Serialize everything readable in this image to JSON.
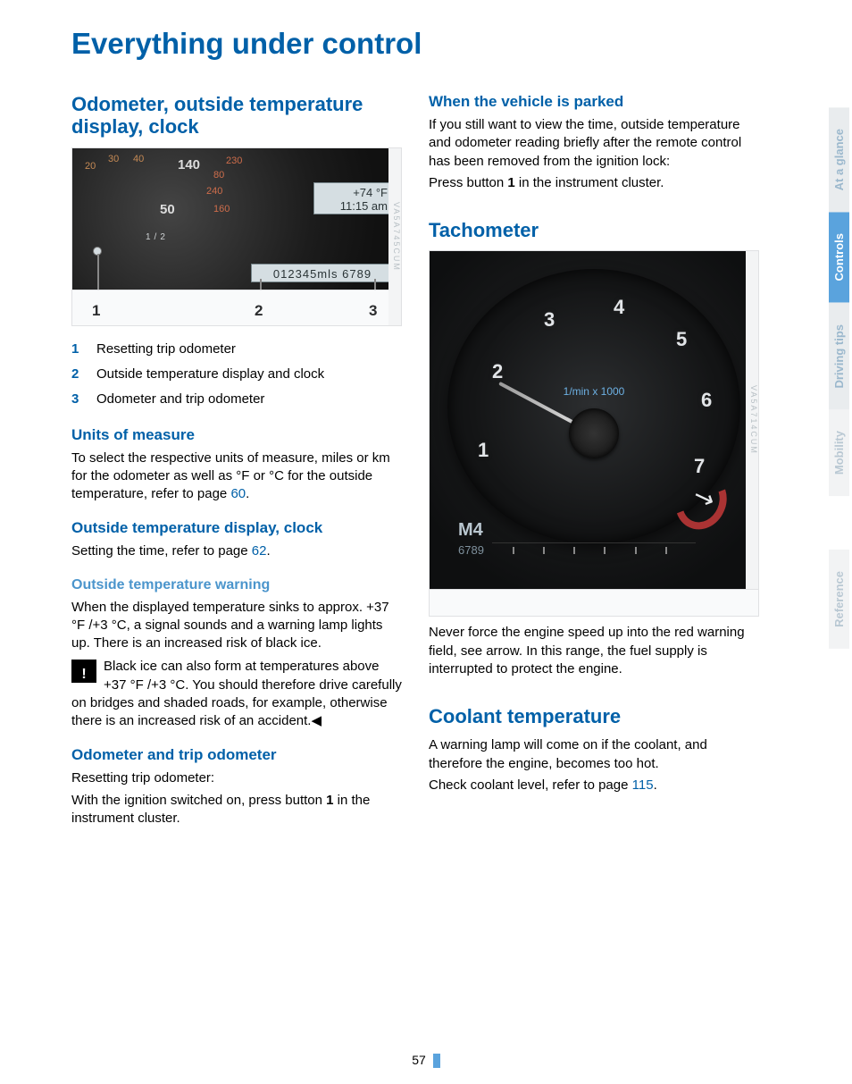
{
  "title": "Everything under control",
  "left": {
    "section1_heading": "Odometer, outside temperature display, clock",
    "fig1_lcd_line1": "+74 °F",
    "fig1_lcd_line2": "11:15 am",
    "fig1_lcd_odo": "012345mls 6789",
    "fig1_speed_20": "20",
    "fig1_speed_30": "30",
    "fig1_speed_40": "40",
    "fig1_kmh_140": "140",
    "fig1_kmh_50": "50",
    "fig1_r_230": "230",
    "fig1_r_80": "80",
    "fig1_r_240": "240",
    "fig1_r_160": "160",
    "fig1_fuel": "1/2",
    "fig1_sidecode": "VA5A745CUM",
    "fig1_p1": "1",
    "fig1_p2": "2",
    "fig1_p3": "3",
    "legend": [
      {
        "num": "1",
        "text": "Resetting trip odometer"
      },
      {
        "num": "2",
        "text": "Outside temperature display and clock"
      },
      {
        "num": "3",
        "text": "Odometer and trip odometer"
      }
    ],
    "sub_units_h": "Units of measure",
    "sub_units_p_a": "To select the respective units of measure, miles or km for the odometer as well as  °F  or  °C for the outside temperature, refer to page ",
    "sub_units_ref": "60",
    "sub_units_p_b": ".",
    "sub_ot_h": "Outside temperature display, clock",
    "sub_ot_p_a": "Setting the time, refer to page ",
    "sub_ot_ref": "62",
    "sub_ot_p_b": ".",
    "sub_warn_h": "Outside temperature warning",
    "sub_warn_p": "When the displayed temperature sinks to approx. +37 °F /+3 °C, a signal sounds and a warning lamp lights up. There is an increased risk of black ice.",
    "warn_box": "Black ice can also form at temperatures above +37 °F /+3 °C. You should therefore drive carefully on bridges and shaded roads, for example, otherwise there is an increased risk of an accident.◀",
    "sub_odo_h": "Odometer and trip odometer",
    "sub_odo_p1": "Resetting trip odometer:",
    "sub_odo_p2a": "With the ignition switched on, press button ",
    "sub_odo_p2b": "1",
    "sub_odo_p2c": " in the instrument cluster."
  },
  "right": {
    "sub_parked_h": "When the vehicle is parked",
    "sub_parked_p1": "If you still want to view the time, outside temperature and odometer reading briefly after the remote control has been removed from the ignition lock:",
    "sub_parked_p2a": "Press button ",
    "sub_parked_p2b": "1",
    "sub_parked_p2c": " in the instrument cluster.",
    "tach_h": "Tachometer",
    "tach_unit": "1/min x 1000",
    "tach_n1": "1",
    "tach_n2": "2",
    "tach_n3": "3",
    "tach_n4": "4",
    "tach_n5": "5",
    "tach_n6": "6",
    "tach_n7": "7",
    "tach_M": "M4",
    "tach_sub": "6789",
    "tach_arrow": "↘",
    "tach_sidecode": "VA5A714CUM",
    "tach_p": "Never force the engine speed up into the red warning field, see arrow. In this range, the fuel supply is interrupted to protect the engine.",
    "cool_h": "Coolant temperature",
    "cool_p1": "A warning lamp will come on if the coolant, and therefore the engine, becomes too hot.",
    "cool_p2a": "Check coolant level, refer to page ",
    "cool_ref": "115",
    "cool_p2b": "."
  },
  "tabs": {
    "t1": "At a glance",
    "t2": "Controls",
    "t3": "Driving tips",
    "t4": "Mobility",
    "t5": "Reference"
  },
  "page_number": "57"
}
